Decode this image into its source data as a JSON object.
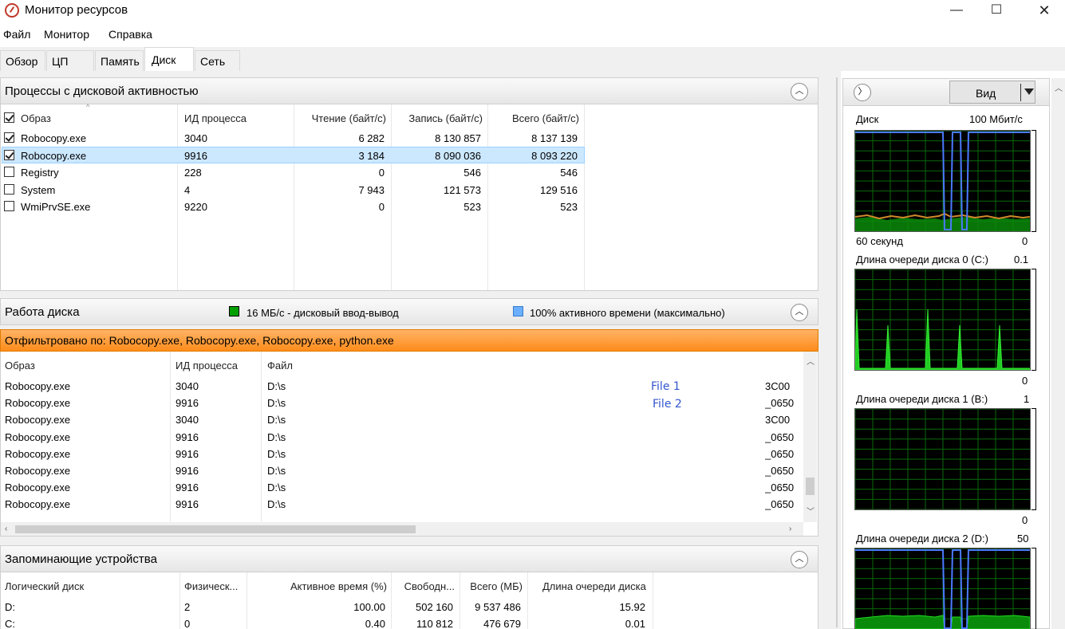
{
  "window": {
    "title": "Монитор ресурсов",
    "minimize": "—",
    "maximize": "☐",
    "close": "✕"
  },
  "menu": [
    "Файл",
    "Монитор",
    "Справка"
  ],
  "tabs": [
    "Обзор",
    "ЦП",
    "Память",
    "Диск",
    "Сеть"
  ],
  "active_tab": "Диск",
  "processes": {
    "title": "Процессы с дисковой активностью",
    "columns": [
      "Образ",
      "ИД процесса",
      "Чтение (байт/с)",
      "Запись (байт/с)",
      "Всего (байт/с)"
    ],
    "rows": [
      {
        "checked": true,
        "image": "Robocopy.exe",
        "pid": "3040",
        "read": "6 282",
        "write": "8 130 857",
        "total": "8 137 139"
      },
      {
        "checked": true,
        "image": "Robocopy.exe",
        "pid": "9916",
        "read": "3 184",
        "write": "8 090 036",
        "total": "8 093 220"
      },
      {
        "checked": false,
        "image": "Registry",
        "pid": "228",
        "read": "0",
        "write": "546",
        "total": "546"
      },
      {
        "checked": false,
        "image": "System",
        "pid": "4",
        "read": "7 943",
        "write": "121 573",
        "total": "129 516"
      },
      {
        "checked": false,
        "image": "WmiPrvSE.exe",
        "pid": "9220",
        "read": "0",
        "write": "523",
        "total": "523"
      }
    ],
    "selected_row": 1
  },
  "disk_activity": {
    "title": "Работа диска",
    "legend_io": "16 МБ/с - дисковый ввод-вывод",
    "legend_io_color": "#00a000",
    "legend_active": "100% активного времени (максимально)",
    "legend_active_color": "#6ab0ff",
    "filter": "Отфильтровано по: Robocopy.exe, Robocopy.exe, Robocopy.exe, python.exe",
    "columns": [
      "Образ",
      "ИД процесса",
      "Файл"
    ],
    "rows": [
      {
        "image": "Robocopy.exe",
        "pid": "3040",
        "file": "D:\\s",
        "tail": "3C00"
      },
      {
        "image": "Robocopy.exe",
        "pid": "9916",
        "file": "D:\\s",
        "tail": "_0650"
      },
      {
        "image": "Robocopy.exe",
        "pid": "3040",
        "file": "D:\\s",
        "tail": "3C00"
      },
      {
        "image": "Robocopy.exe",
        "pid": "9916",
        "file": "D:\\s",
        "tail": "_0650"
      },
      {
        "image": "Robocopy.exe",
        "pid": "9916",
        "file": "D:\\s",
        "tail": "_0650"
      },
      {
        "image": "Robocopy.exe",
        "pid": "9916",
        "file": "D:\\s",
        "tail": "_0650"
      },
      {
        "image": "Robocopy.exe",
        "pid": "9916",
        "file": "D:\\s",
        "tail": "_0650"
      },
      {
        "image": "Robocopy.exe",
        "pid": "9916",
        "file": "D:\\s",
        "tail": "_0650"
      }
    ],
    "file_labels": [
      "File 1",
      "File 2"
    ]
  },
  "storage": {
    "title": "Запоминающие устройства",
    "columns": [
      "Логический диск",
      "Физическ...",
      "Активное время (%)",
      "Свободн...",
      "Всего (МБ)",
      "Длина очереди диска"
    ],
    "rows": [
      {
        "logical": "D:",
        "physical": "2",
        "active": "100.00",
        "free": "502 160",
        "total": "9 537 486",
        "queue": "15.92"
      },
      {
        "logical": "C:",
        "physical": "0",
        "active": "0.40",
        "free": "110 812",
        "total": "476 679",
        "queue": "0.01"
      }
    ]
  },
  "right_pane": {
    "view_button": "Вид",
    "graphs": [
      {
        "title": "Диск",
        "max": "100 Мбит/с",
        "time": "60 секунд",
        "min": "0"
      },
      {
        "title": "Длина очереди диска 0 (C:)",
        "max": "0.1",
        "min": "0"
      },
      {
        "title": "Длина очереди диска 1 (B:)",
        "max": "1",
        "min": "0"
      },
      {
        "title": "Длина очереди диска 2 (D:)",
        "max": "50"
      }
    ]
  }
}
